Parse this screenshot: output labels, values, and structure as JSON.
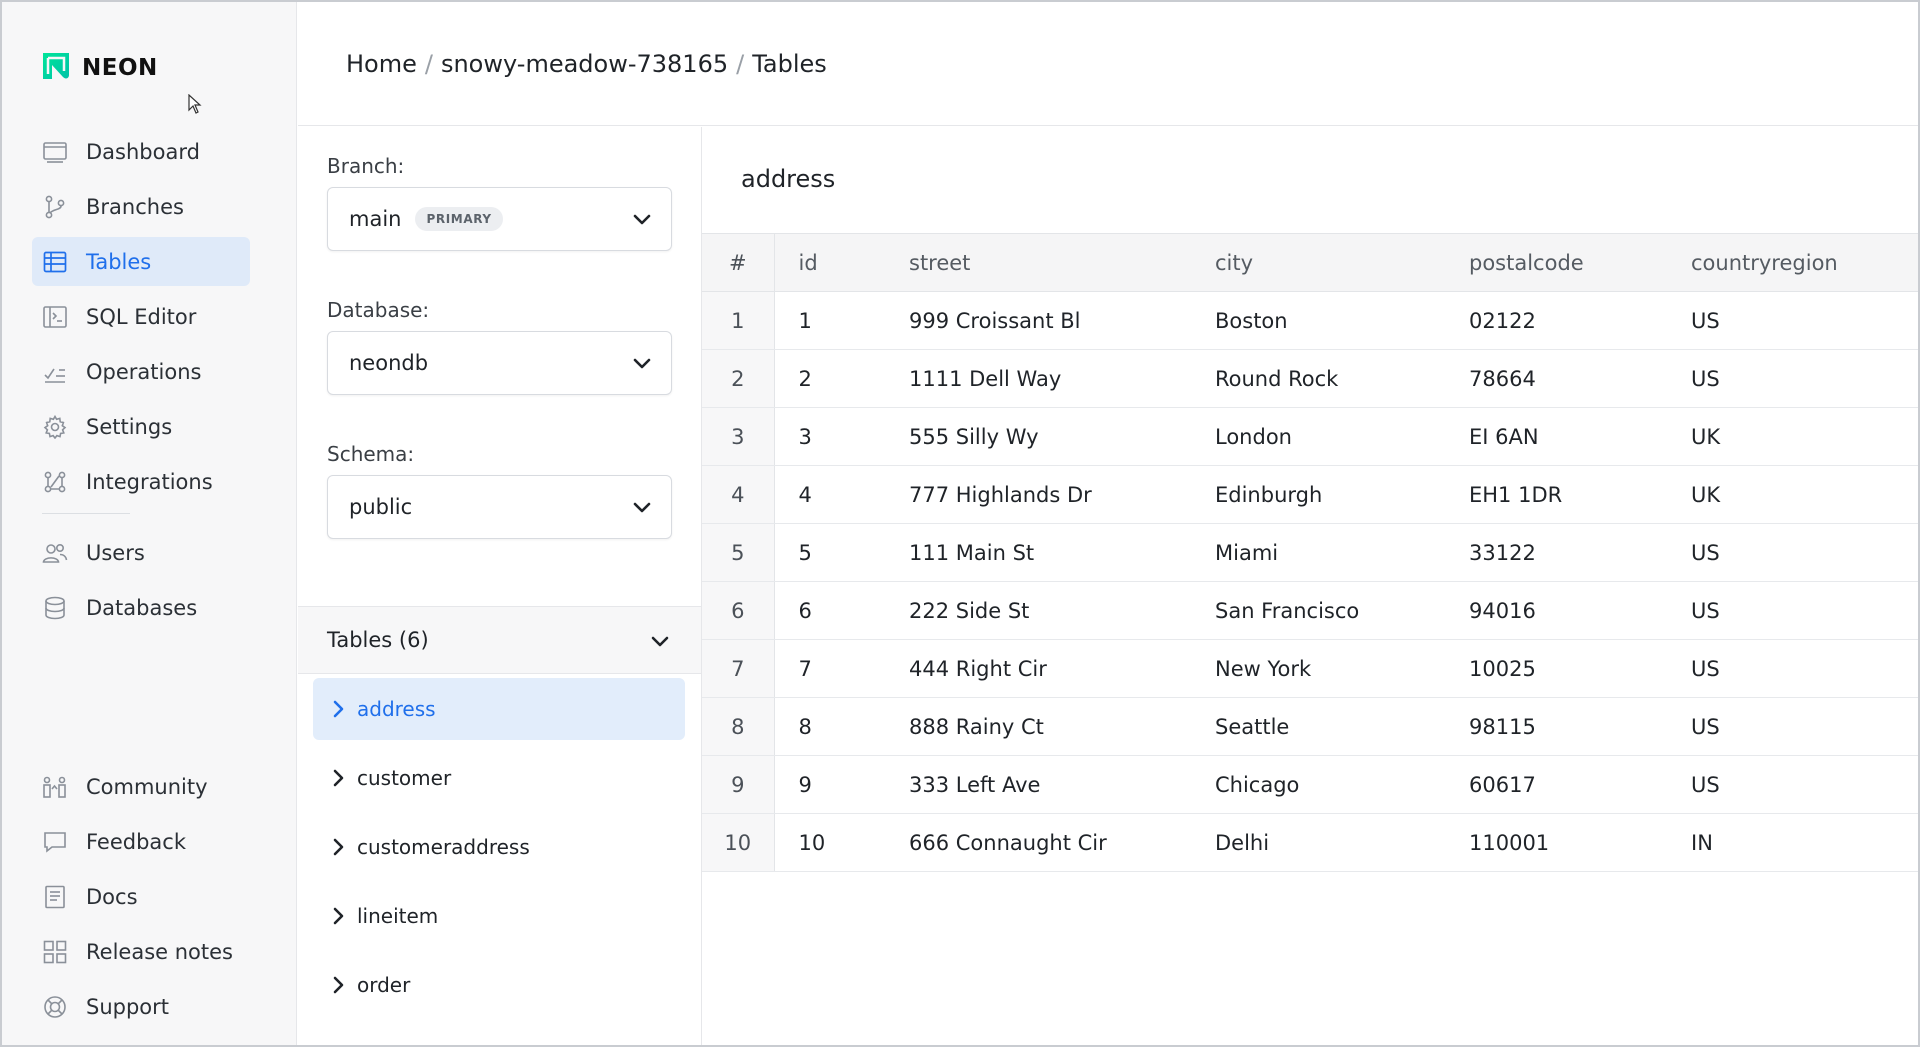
{
  "brand": {
    "name": "NEON"
  },
  "sidebar": {
    "items": [
      {
        "label": "Dashboard",
        "icon": "dashboard-icon"
      },
      {
        "label": "Branches",
        "icon": "branch-icon"
      },
      {
        "label": "Tables",
        "icon": "table-icon",
        "active": true
      },
      {
        "label": "SQL Editor",
        "icon": "sql-editor-icon"
      },
      {
        "label": "Operations",
        "icon": "operations-icon"
      },
      {
        "label": "Settings",
        "icon": "gear-icon"
      },
      {
        "label": "Integrations",
        "icon": "integrations-icon"
      },
      {
        "label": "Users",
        "icon": "users-icon"
      },
      {
        "label": "Databases",
        "icon": "database-icon"
      }
    ],
    "bottom_items": [
      {
        "label": "Community",
        "icon": "community-icon"
      },
      {
        "label": "Feedback",
        "icon": "feedback-icon"
      },
      {
        "label": "Docs",
        "icon": "docs-icon"
      },
      {
        "label": "Release notes",
        "icon": "release-notes-icon"
      },
      {
        "label": "Support",
        "icon": "support-icon"
      }
    ]
  },
  "breadcrumb": {
    "home": "Home",
    "project": "snowy-meadow-738165",
    "page": "Tables",
    "separator": "/"
  },
  "filters": {
    "branch_label": "Branch:",
    "branch_value": "main",
    "branch_badge": "PRIMARY",
    "database_label": "Database:",
    "database_value": "neondb",
    "schema_label": "Schema:",
    "schema_value": "public"
  },
  "tables_panel": {
    "header": "Tables (6)",
    "items": [
      "address",
      "customer",
      "customeraddress",
      "lineitem",
      "order"
    ],
    "active": "address"
  },
  "table_view": {
    "title": "address",
    "columns": [
      "#",
      "id",
      "street",
      "city",
      "postalcode",
      "countryregion"
    ],
    "rows": [
      [
        "1",
        "1",
        "999 Croissant Bl",
        "Boston",
        "02122",
        "US"
      ],
      [
        "2",
        "2",
        "1111 Dell Way",
        "Round Rock",
        "78664",
        "US"
      ],
      [
        "3",
        "3",
        "555 Silly Wy",
        "London",
        "EI 6AN",
        "UK"
      ],
      [
        "4",
        "4",
        "777 Highlands Dr",
        "Edinburgh",
        "EH1 1DR",
        "UK"
      ],
      [
        "5",
        "5",
        "111 Main St",
        "Miami",
        "33122",
        "US"
      ],
      [
        "6",
        "6",
        "222 Side St",
        "San Francisco",
        "94016",
        "US"
      ],
      [
        "7",
        "7",
        "444 Right Cir",
        "New York",
        "10025",
        "US"
      ],
      [
        "8",
        "8",
        "888 Rainy Ct",
        "Seattle",
        "98115",
        "US"
      ],
      [
        "9",
        "9",
        "333 Left Ave",
        "Chicago",
        "60617",
        "US"
      ],
      [
        "10",
        "10",
        "666 Connaught Cir",
        "Delhi",
        "110001",
        "IN"
      ]
    ]
  },
  "colors": {
    "accent": "#1f6feb",
    "active_bg": "#dfeaf9",
    "logo_green": "#00e599"
  }
}
